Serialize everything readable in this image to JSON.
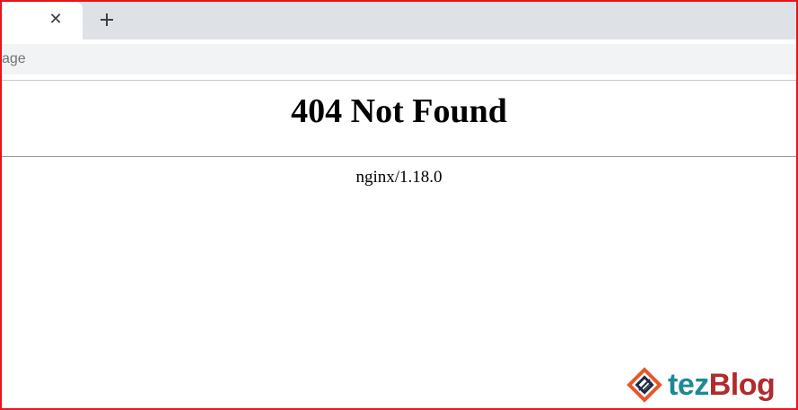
{
  "browser": {
    "tab_close_glyph": "✕",
    "new_tab_glyph": "+",
    "address_text": "age"
  },
  "page": {
    "heading": "404 Not Found",
    "server": "nginx/1.18.0"
  },
  "watermark": {
    "part_a": "tez",
    "part_b": "Blog"
  },
  "colors": {
    "frame_border": "#e8141a",
    "tabstrip": "#dee1e6",
    "omnibox": "#f1f3f4",
    "watermark_teal": "#1c8a94",
    "watermark_red": "#b22a2a"
  }
}
